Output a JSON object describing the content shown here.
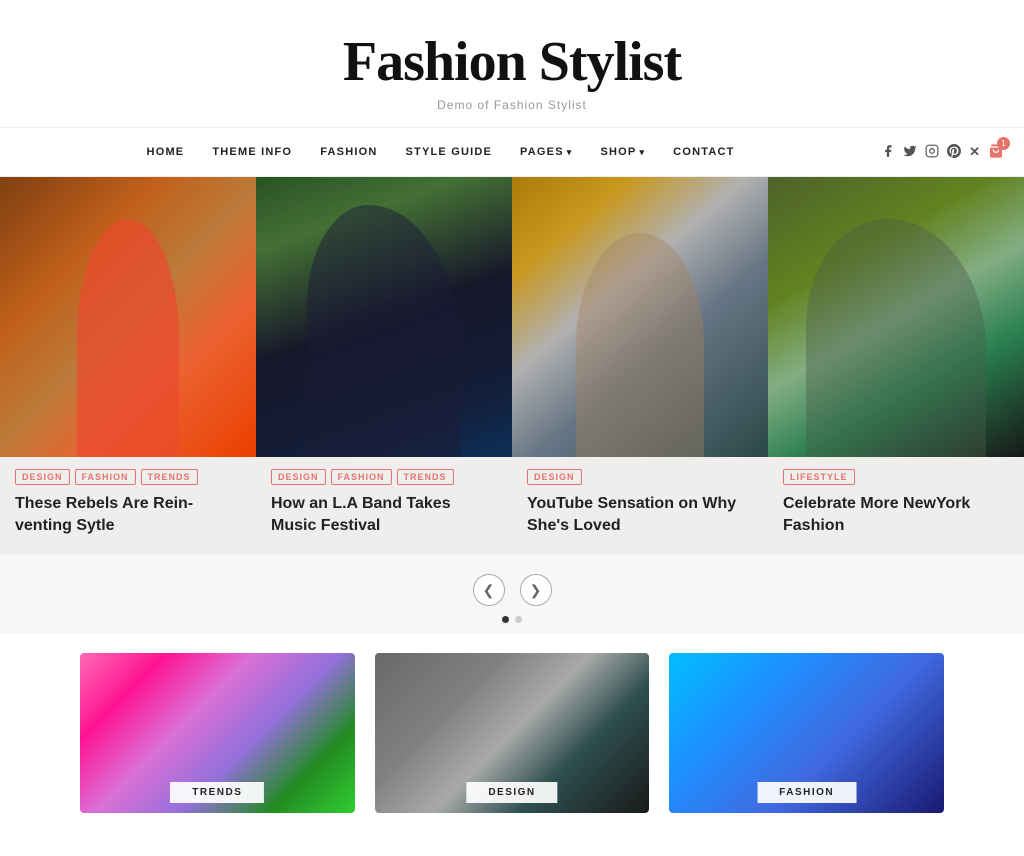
{
  "header": {
    "title": "Fashion Stylist",
    "subtitle": "Demo of Fashion Stylist"
  },
  "nav": {
    "links": [
      {
        "label": "HOME",
        "hasDropdown": false
      },
      {
        "label": "THEME INFO",
        "hasDropdown": false
      },
      {
        "label": "FASHION",
        "hasDropdown": false
      },
      {
        "label": "STYLE GUIDE",
        "hasDropdown": false
      },
      {
        "label": "PAGES",
        "hasDropdown": true
      },
      {
        "label": "SHOP",
        "hasDropdown": true
      },
      {
        "label": "CONTACT",
        "hasDropdown": false
      }
    ],
    "social_icons": [
      "f",
      "t",
      "i",
      "p",
      "x"
    ],
    "cart_count": "1"
  },
  "carousel": {
    "cards": [
      {
        "tags": [
          "DESIGN",
          "FASHION",
          "TRENDS"
        ],
        "title": "These Rebels Are Rein-venting Sytle",
        "img_class": "img-rebel"
      },
      {
        "tags": [
          "DESIGN",
          "FASHION",
          "TRENDS"
        ],
        "title": "How an L.A Band Takes Music Festival",
        "img_class": "img-band"
      },
      {
        "tags": [
          "DESIGN"
        ],
        "title": "YouTube Sensation on Why She's Loved",
        "img_class": "img-youtube"
      },
      {
        "tags": [
          "LIFESTYLE"
        ],
        "title": "Celebrate More NewYork Fashion",
        "img_class": "img-newyork"
      }
    ],
    "prev_arrow": "❮",
    "next_arrow": "❯"
  },
  "bottom_grid": {
    "cards": [
      {
        "label": "TRENDS",
        "img_class": "img-trends-bottom"
      },
      {
        "label": "DESIGN",
        "img_class": "img-design-bottom"
      },
      {
        "label": "FASHION",
        "img_class": "img-fashion-bottom"
      }
    ]
  }
}
